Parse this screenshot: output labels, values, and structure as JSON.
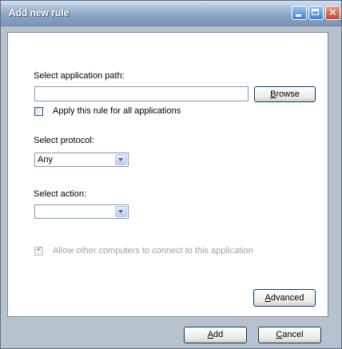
{
  "window": {
    "title": "Add new rule",
    "controls": {
      "minimize": "minimize-icon",
      "maximize": "maximize-icon",
      "close": "close-icon"
    }
  },
  "form": {
    "app_path_label": "Select application path:",
    "app_path_value": "",
    "browse_prefix": "",
    "browse_access_key": "B",
    "browse_suffix": "rowse",
    "apply_all_label": "Apply this rule for all applications",
    "apply_all_checked": false,
    "protocol_label": "Select protocol:",
    "protocol_selected": "Any",
    "action_label": "Select action:",
    "action_selected": "",
    "allow_label": "Allow other computers to connect to this application",
    "allow_checked": true,
    "allow_enabled": false,
    "advanced_prefix": "",
    "advanced_access_key": "A",
    "advanced_suffix": "dvanced"
  },
  "footer": {
    "add_prefix": "",
    "add_access_key": "A",
    "add_suffix": "dd",
    "cancel_prefix": "",
    "cancel_access_key": "C",
    "cancel_suffix": "ancel"
  },
  "colors": {
    "titlebar": "#8aa3c2",
    "frame": "#b8c2cc",
    "client": "#ffffff",
    "disabled_text": "#a0a0a0"
  }
}
